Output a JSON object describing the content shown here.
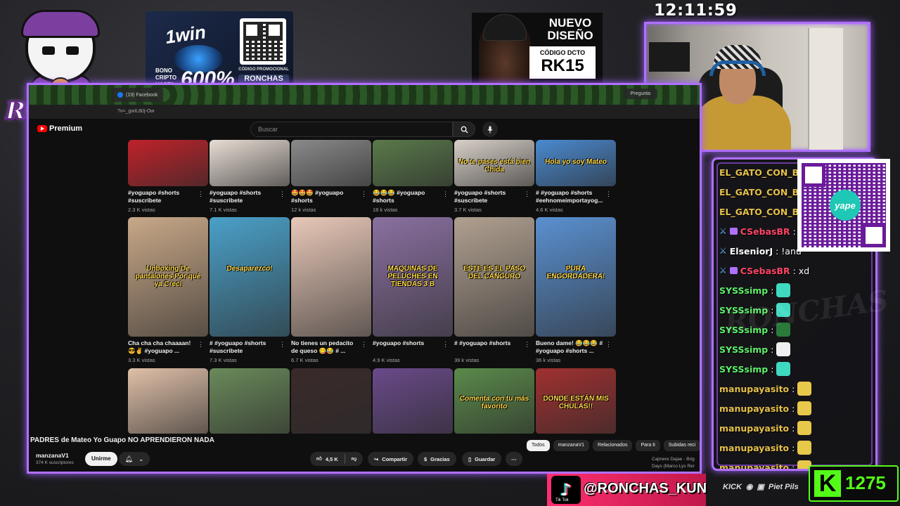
{
  "clock": "12:11:59",
  "logo": {
    "text": "RONCHAS"
  },
  "sponsor_1win": {
    "brand": "1win",
    "bono": "BONO\nCRIPTO\nHASTA",
    "percent": "600%",
    "code_label": "CÓDIGO PROMOCIONAL",
    "code": "RONCHAS"
  },
  "sponsor_design": {
    "title": "NUEVO DISEÑO",
    "code_label": "CÓDIGO DCTO",
    "code": "RK15"
  },
  "browser": {
    "tab_text": "(19) Facebook",
    "tab_right": "Pregunta",
    "url": "?v=_gwIL80j-Ow"
  },
  "youtube": {
    "logo_text": "Premium",
    "search_placeholder": "Buscar",
    "search_icon": "search-icon",
    "mic_icon": "mic-icon",
    "video_title": "PADRES de Mateo Yo Guapo NO APRENDIERON NADA",
    "channel_name": "manzanaV1",
    "channel_subs": "374 K suscriptores",
    "subscribe_label": "Unirme",
    "likes": "4,5 K",
    "share_label": "Compartir",
    "thanks_label": "Gracias",
    "save_label": "Guardar",
    "chips": [
      "Todos",
      "manzanaV1",
      "Relacionados",
      "Para ti",
      "Subidas reci"
    ],
    "side_video_title": "Cajmere Dajae - Brig",
    "side_video_sub": "Days (Marco Lys Rer"
  },
  "shorts_row1": [
    {
      "title": "#yoguapo #shorts #suscribete",
      "views": "2.3 K vistas",
      "overlay": ""
    },
    {
      "title": "#yoguapo #shorts #suscribete",
      "views": "7.1 K vistas",
      "overlay": ""
    },
    {
      "title": "🤩🤩🤩 #yoguapo #shorts",
      "views": "12 k vistas",
      "overlay": ""
    },
    {
      "title": "😂😂😂 #yoguapo #shorts",
      "views": "18 k vistas",
      "overlay": ""
    },
    {
      "title": "#yoguapo #shorts #suscribete",
      "views": "3.7 K vistas",
      "overlay": "No te pases está bien Chida"
    },
    {
      "title": "# #yoguapo #shorts #eehnomeimportayog...",
      "views": "4.6 K vistas",
      "overlay": "Hola yo soy Mateo"
    }
  ],
  "shorts_row2": [
    {
      "title": "Cha cha cha chaaaan! 😎✌️ #yoguapo ...",
      "views": "3.3 K vistas",
      "overlay": "Unboxing De pantalones Por qué ya Crecí"
    },
    {
      "title": "# #yoguapo #shorts #suscribete",
      "views": "7.3 K vistas",
      "overlay": "Desaparezco!"
    },
    {
      "title": "No tienes un pedacito de queso 😋😂 # ...",
      "views": "6.7 K vistas",
      "overlay": ""
    },
    {
      "title": "#yoguapo #shorts",
      "views": "4.9 K vistas",
      "overlay": "MAQUINAS DE PELUCHES EN TIENDAS 3 B"
    },
    {
      "title": "# #yoguapo #shorts",
      "views": "39 k vistas",
      "overlay": "ESTE ES EL PASO DEL CANGURO"
    },
    {
      "title": "Bueno dame! 😂😂😂 # #yoguapo #shorts ...",
      "views": "36 k vistas",
      "overlay": "PURA ENGORDADERA!"
    }
  ],
  "shorts_row3": [
    {
      "overlay": ""
    },
    {
      "overlay": ""
    },
    {
      "overlay": ""
    },
    {
      "overlay": ""
    },
    {
      "overlay": "Comenta con tu más favorito"
    },
    {
      "overlay": "DONDE ESTÁN MIS CHULAS!!"
    }
  ],
  "chat": [
    {
      "user": "EL_GATO_CON_BO",
      "color": "#e6c04a",
      "text": "",
      "sword": false,
      "badge": false,
      "emote": ""
    },
    {
      "user": "EL_GATO_CON_BO",
      "color": "#e6c04a",
      "text": "",
      "sword": false,
      "badge": false,
      "emote": ""
    },
    {
      "user": "EL_GATO_CON_BO",
      "color": "#e6c04a",
      "text": "",
      "sword": false,
      "badge": false,
      "emote": ""
    },
    {
      "user": "CSebasBR",
      "color": "#ff4466",
      "text": ": c",
      "sword": true,
      "badge": true,
      "emote": ""
    },
    {
      "user": "ElseniorJ",
      "color": "#ffffff",
      "text": ": !anu",
      "sword": true,
      "badge": false,
      "emote": ""
    },
    {
      "user": "CSebasBR",
      "color": "#ff4466",
      "text": ": xd",
      "sword": true,
      "badge": true,
      "emote": ""
    },
    {
      "user": "SYSSsimp",
      "color": "#5ef06a",
      "text": ":",
      "sword": false,
      "badge": false,
      "emote": "#3fd9c0"
    },
    {
      "user": "SYSSsimp",
      "color": "#5ef06a",
      "text": ":",
      "sword": false,
      "badge": false,
      "emote": "#3fd9c0"
    },
    {
      "user": "SYSSsimp",
      "color": "#5ef06a",
      "text": ":",
      "sword": false,
      "badge": false,
      "emote": "#2a7a3a"
    },
    {
      "user": "SYSSsimp",
      "color": "#5ef06a",
      "text": ":",
      "sword": false,
      "badge": false,
      "emote": "#f0f0f0"
    },
    {
      "user": "SYSSsimp",
      "color": "#5ef06a",
      "text": ":",
      "sword": false,
      "badge": false,
      "emote": "#3fd9c0"
    },
    {
      "user": "manupayasito",
      "color": "#e6c04a",
      "text": ":",
      "sword": false,
      "badge": false,
      "emote": "#e8c84a"
    },
    {
      "user": "manupayasito",
      "color": "#e6c04a",
      "text": ":",
      "sword": false,
      "badge": false,
      "emote": "#e8c84a"
    },
    {
      "user": "manupayasito",
      "color": "#e6c04a",
      "text": ":",
      "sword": false,
      "badge": false,
      "emote": "#e8c84a"
    },
    {
      "user": "manupayasito",
      "color": "#e6c04a",
      "text": ":",
      "sword": false,
      "badge": false,
      "emote": "#e8c84a"
    },
    {
      "user": "manupayasito",
      "color": "#e6c04a",
      "text": ":",
      "sword": false,
      "badge": false,
      "emote": "#e8c84a"
    }
  ],
  "yape": {
    "logo_text": "yape"
  },
  "tiktok": {
    "handle": "@RONCHAS_KUN",
    "label": "Tik Tok"
  },
  "socials": {
    "kick": "KICK",
    "other": "Piet Pils"
  },
  "kick_counter": {
    "value": "1275"
  },
  "watermark": "RONCHAS",
  "colors": {
    "frame": "#b070ff",
    "kick": "#53fc18",
    "tiktok": "#ff2f6e"
  }
}
